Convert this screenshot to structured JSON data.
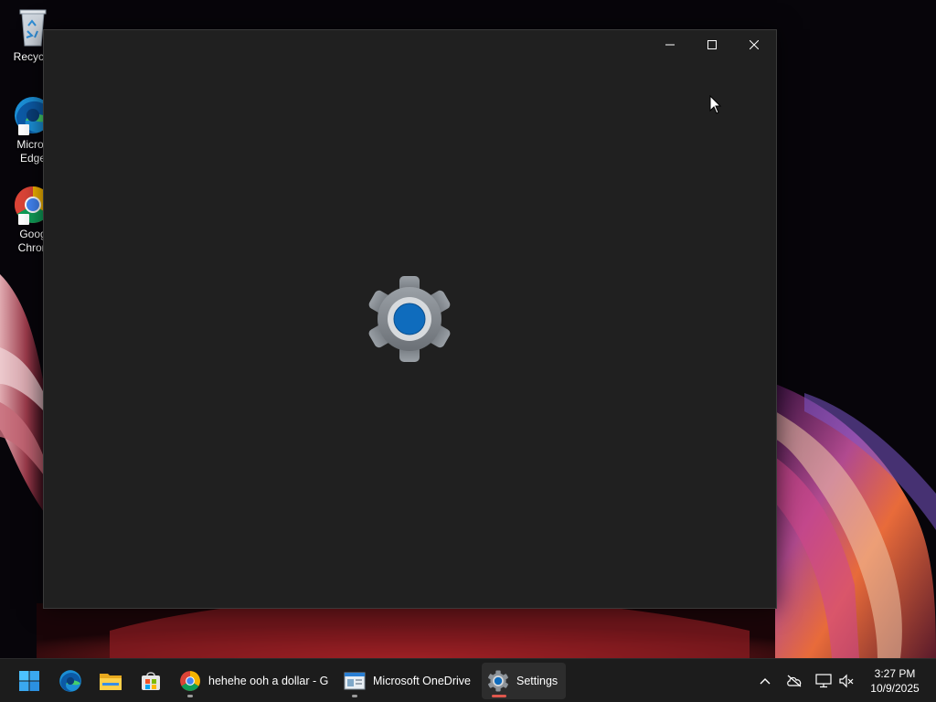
{
  "desktop": {
    "icons": [
      {
        "label": "Recycle",
        "icon": "recycle-bin-icon"
      },
      {
        "label": "Micros Edge",
        "icon": "edge-icon"
      },
      {
        "label": "Goog Chron",
        "icon": "chrome-icon"
      }
    ]
  },
  "window": {
    "app": "Settings",
    "state": "loading-splash",
    "splash_icon": "settings-gear-icon",
    "caption_buttons": [
      "minimize-icon",
      "maximize-icon",
      "close-icon"
    ],
    "background": "#202020"
  },
  "taskbar": {
    "start_icon": "windows-start-icon",
    "pinned": [
      {
        "name": "Microsoft Edge",
        "icon": "edge-icon"
      },
      {
        "name": "File Explorer",
        "icon": "folder-icon"
      },
      {
        "name": "Microsoft Store",
        "icon": "store-icon"
      }
    ],
    "apps": [
      {
        "label": "hehehe ooh a dollar - G",
        "icon": "chrome-icon",
        "running": true
      },
      {
        "label": "Microsoft OneDrive",
        "icon": "onedrive-window-icon",
        "running": true
      },
      {
        "label": "Settings",
        "icon": "settings-gear-icon",
        "running": true,
        "active": true
      }
    ],
    "tray": {
      "icons": [
        "chevron-up-icon",
        "onedrive-offline-icon",
        "network-icon",
        "volume-muted-icon"
      ]
    },
    "clock": {
      "time": "3:27 PM",
      "date": "10/9/2025"
    }
  },
  "colors": {
    "accent": "#0f6cbd",
    "active_indicator": "#e0574d",
    "taskbar": "#1c1c1c"
  }
}
